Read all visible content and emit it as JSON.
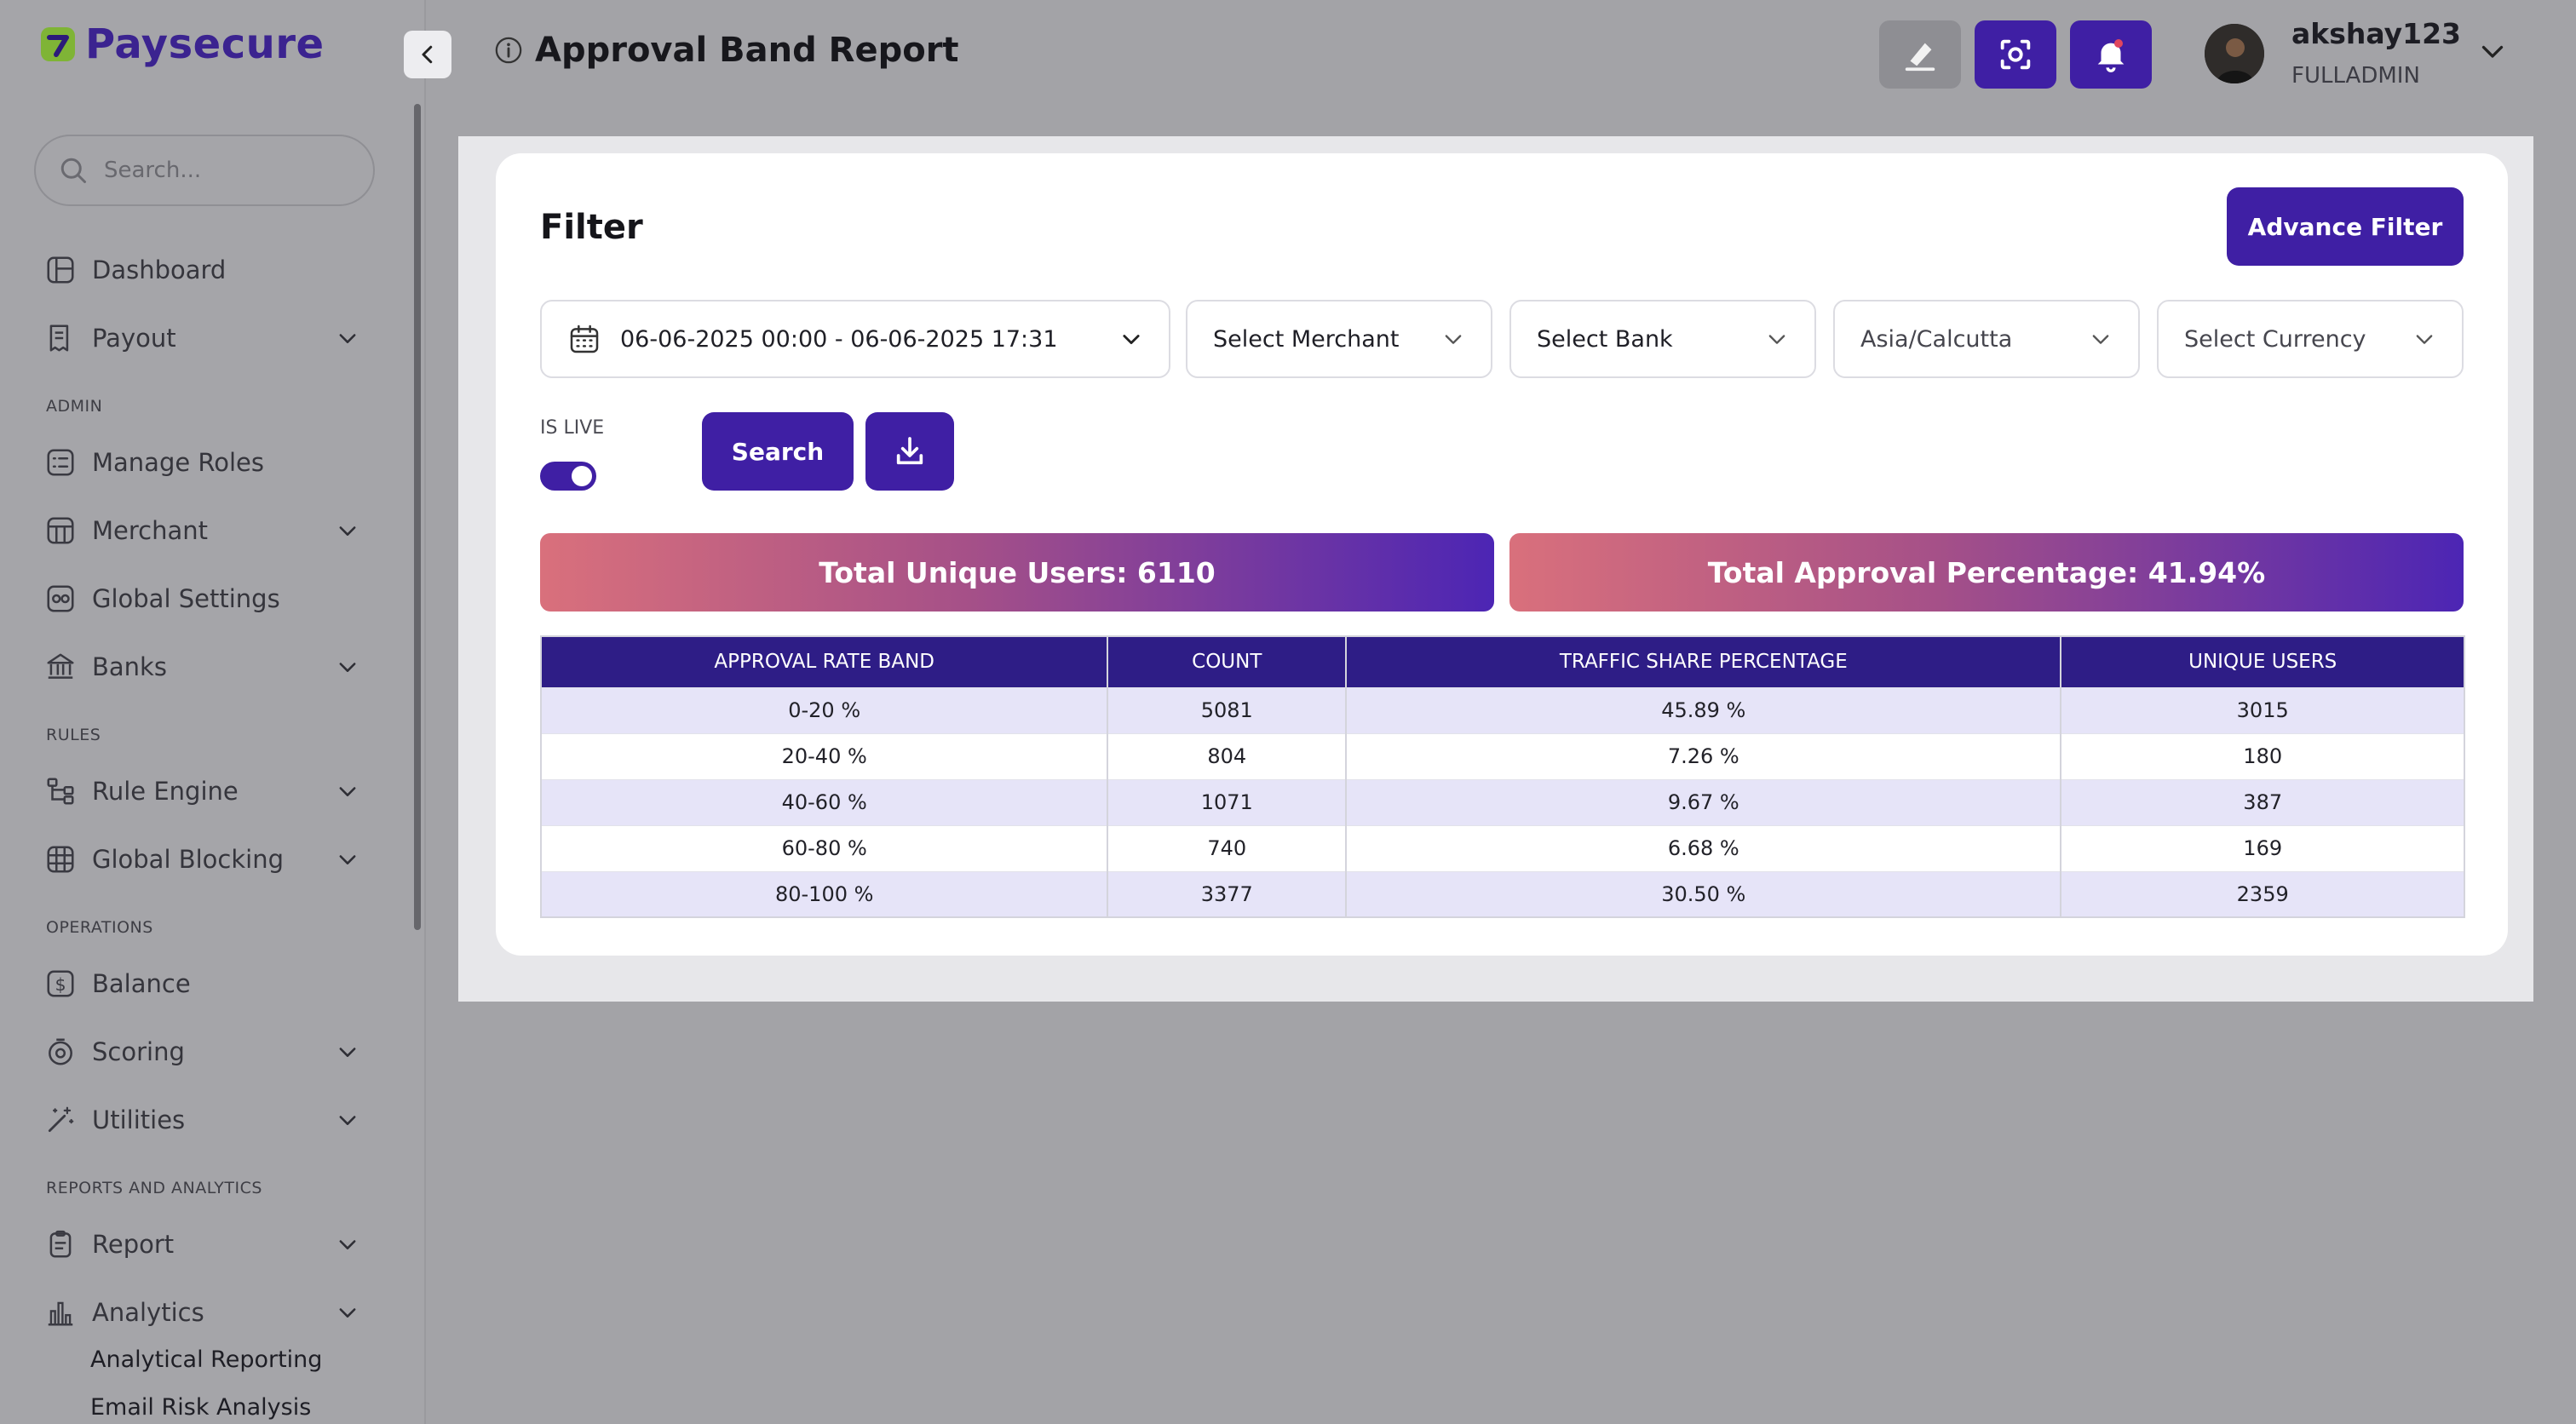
{
  "brand": {
    "name": "Paysecure"
  },
  "sidebar": {
    "search_placeholder": "Search...",
    "items": [
      {
        "label": "Dashboard"
      },
      {
        "label": "Payout"
      },
      {
        "label": "Manage Roles"
      },
      {
        "label": "Merchant"
      },
      {
        "label": "Global Settings"
      },
      {
        "label": "Banks"
      },
      {
        "label": "Rule Engine"
      },
      {
        "label": "Global Blocking"
      },
      {
        "label": "Balance"
      },
      {
        "label": "Scoring"
      },
      {
        "label": "Utilities"
      },
      {
        "label": "Report"
      },
      {
        "label": "Analytics"
      }
    ],
    "sections": {
      "admin": "ADMIN",
      "rules": "RULES",
      "operations": "OPERATIONS",
      "reports": "REPORTS AND ANALYTICS"
    },
    "sub_items": [
      {
        "label": "Analytical Reporting"
      },
      {
        "label": "Email Risk Analysis"
      }
    ]
  },
  "header": {
    "title": "Approval Band Report",
    "user": {
      "name": "akshay123",
      "role": "FULLADMIN"
    }
  },
  "filter": {
    "title": "Filter",
    "advance_filter": "Advance Filter",
    "date_range": "06-06-2025 00:00 - 06-06-2025 17:31",
    "merchant_placeholder": "Select Merchant",
    "bank_placeholder": "Select Bank",
    "timezone": "Asia/Calcutta",
    "currency_placeholder": "Select Currency",
    "is_live_label": "IS LIVE",
    "is_live": true,
    "search_label": "Search"
  },
  "stats": {
    "unique_users": "Total Unique Users: 6110",
    "approval_percentage": "Total Approval Percentage: 41.94%"
  },
  "table": {
    "headers": [
      "APPROVAL RATE BAND",
      "COUNT",
      "TRAFFIC SHARE PERCENTAGE",
      "UNIQUE USERS"
    ],
    "rows": [
      [
        "0-20 %",
        "5081",
        "45.89 %",
        "3015"
      ],
      [
        "20-40 %",
        "804",
        "7.26 %",
        "180"
      ],
      [
        "40-60 %",
        "1071",
        "9.67 %",
        "387"
      ],
      [
        "60-80 %",
        "740",
        "6.68 %",
        "169"
      ],
      [
        "80-100 %",
        "3377",
        "30.50 %",
        "2359"
      ]
    ]
  },
  "colors": {
    "accent": "#3f1fa4",
    "table_header": "#2e1d86",
    "row_alt": "#e6e4f8",
    "gradient_start": "#d9707c",
    "gradient_end": "#4c25b4"
  }
}
